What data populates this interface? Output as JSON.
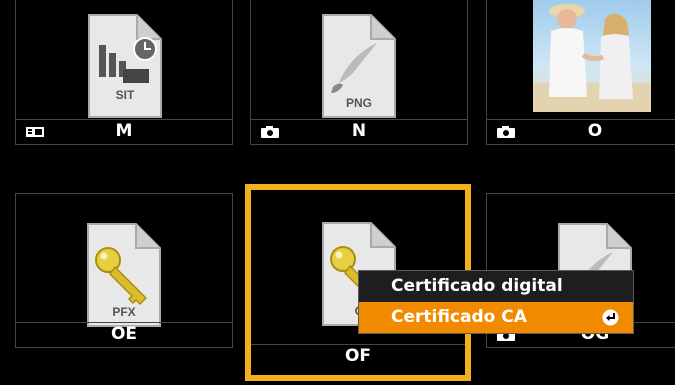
{
  "tiles": [
    {
      "label": "M",
      "file_type": "SIT",
      "source_icon": "card-reader-icon"
    },
    {
      "label": "N",
      "file_type": "PNG",
      "source_icon": "camera-icon"
    },
    {
      "label": "O",
      "file_type": "",
      "source_icon": "camera-icon"
    },
    {
      "label": "OE",
      "file_type": "PFX",
      "source_icon": ""
    },
    {
      "label": "OF",
      "file_type": "C",
      "source_icon": "",
      "selected": true
    },
    {
      "label": "OG",
      "file_type": "",
      "source_icon": "camera-icon"
    }
  ],
  "context_menu": {
    "items": [
      {
        "label": "Certificado digital",
        "active": false
      },
      {
        "label": "Certificado CA",
        "active": true
      }
    ]
  },
  "colors": {
    "selection": "#f2b01e",
    "menu_highlight": "#f28a00",
    "background": "#000000"
  }
}
